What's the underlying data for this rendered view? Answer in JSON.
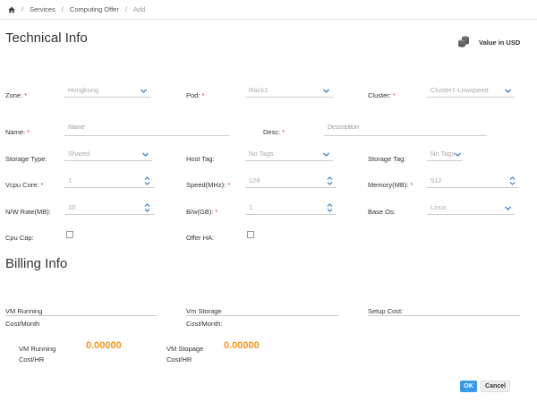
{
  "breadcrumb": {
    "services": "Services",
    "computing_offer": "Computing Offer",
    "add": "Add",
    "sep": "/"
  },
  "technical": {
    "title": "Technical Info",
    "value_in_usd": "Value in USD",
    "zone": {
      "label": "Zone:",
      "value": "Hongkong"
    },
    "pod": {
      "label": "Pod:",
      "value": "Rack1"
    },
    "cluster": {
      "label": "Cluster:",
      "value": "Cluster1-Lowspeed"
    },
    "name": {
      "label": "Name:",
      "placeholder": "Name"
    },
    "desc": {
      "label": "Desc:",
      "placeholder": "Description"
    },
    "storage_type": {
      "label": "Storage Type:",
      "value": "Shared"
    },
    "host_tag": {
      "label": "Host Tag:",
      "value": "No Tags"
    },
    "storage_tag": {
      "label": "Storage Tag:",
      "value": "No Tags"
    },
    "vcpu_core": {
      "label": "Vcpu Core:",
      "value": "1"
    },
    "speed": {
      "label": "Speed(MHz):",
      "value": "128"
    },
    "memory": {
      "label": "Memory(MB):",
      "value": "512"
    },
    "nw_rate": {
      "label": "N/W Rate(MB):",
      "value": "10"
    },
    "bw": {
      "label": "B/w(GB):",
      "value": "1"
    },
    "base_os": {
      "label": "Base Os:",
      "value": "Linux"
    },
    "cpu_cap": {
      "label": "Cpu Cap:"
    },
    "offer_ha": {
      "label": "Offer HA:"
    },
    "required_mark": "*"
  },
  "billing": {
    "title": "Billing Info",
    "vm_running_month": {
      "line1": "VM Running",
      "line2": "Cost/Month"
    },
    "vm_storage_month": {
      "line1": "Vm Storage",
      "line2": "Cost/Month:"
    },
    "setup_cost": {
      "label": "Setup Cost:"
    },
    "vm_running_hr": {
      "line1": "VM Running",
      "line2": "Cost/HR",
      "value": "0.00000"
    },
    "vm_storage_hr": {
      "line1": "VM Stopage",
      "line2": "Cost/HR",
      "value": "0.00000"
    }
  },
  "actions": {
    "ok": "OK",
    "cancel": "Cancel"
  },
  "colors": {
    "accent": "#3a9ae6",
    "money": "#f7941e",
    "required": "#e03030"
  }
}
